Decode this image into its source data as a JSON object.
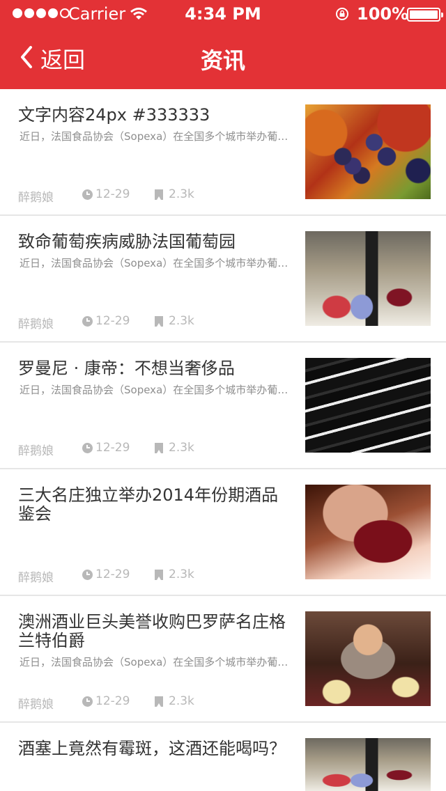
{
  "status_bar": {
    "carrier": "Carrier",
    "time": "4:34 PM",
    "battery": "100%"
  },
  "nav": {
    "back_label": "返回",
    "title": "资讯"
  },
  "colors": {
    "header_bg": "#e33236",
    "title_text": "#333333",
    "meta_text": "#b8b8b8"
  },
  "news": [
    {
      "title": "文字内容24px #333333",
      "summary": "近日，法国食品协会（Sopexa）在全国多个城市举办葡萄酒推广活动",
      "author": "醉鹅娘",
      "date": "12-29",
      "views": "2.3k",
      "image": "grapes-photo"
    },
    {
      "title": "致命葡萄疾病威胁法国葡萄园",
      "summary": "近日，法国食品协会（Sopexa）在全国多个城市举办葡萄酒推广活动",
      "author": "醉鹅娘",
      "date": "12-29",
      "views": "2.3k",
      "image": "wine-table-photo"
    },
    {
      "title": "罗曼尼 · 康帝：不想当奢侈品",
      "summary": "近日，法国食品协会（Sopexa）在全国多个城市举办葡萄酒推广活动",
      "author": "醉鹅娘",
      "date": "12-29",
      "views": "2.3k",
      "image": "wine-bottles-photo"
    },
    {
      "title": "三大名庄独立举办2014年份期酒品鉴会",
      "summary": "",
      "author": "醉鹅娘",
      "date": "12-29",
      "views": "2.3k",
      "image": "wine-glass-photo"
    },
    {
      "title": "澳洲酒业巨头美誉收购巴罗萨名庄格兰特伯爵",
      "summary": "近日，法国食品协会（Sopexa）在全国多个城市举办葡萄酒推广活动",
      "author": "醉鹅娘",
      "date": "12-29",
      "views": "2.3k",
      "image": "dining-woman-photo"
    },
    {
      "title": "酒塞上竟然有霉斑，这酒还能喝吗？",
      "summary": "",
      "author": "",
      "date": "",
      "views": "",
      "image": "wine-table-photo"
    }
  ]
}
